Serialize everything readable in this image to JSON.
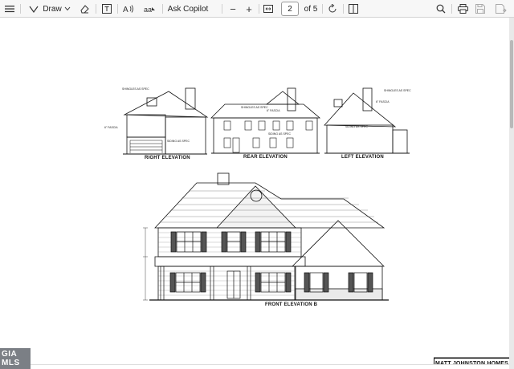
{
  "toolbar": {
    "draw_label": "Draw",
    "ask_copilot_label": "Ask Copilot",
    "zoom_out_label": "−",
    "zoom_in_label": "+",
    "page_current": "2",
    "page_total_label": "of 5"
  },
  "drawing": {
    "right_elevation_label": "RIGHT ELEVATION",
    "rear_elevation_label": "REAR ELEVATION",
    "left_elevation_label": "LEFT ELEVATION",
    "front_elevation_label": "FRONT ELEVATION B",
    "title_block": "MATT JOHNSTON HOMES",
    "note_shingles": "SHINGLES AS SPEC",
    "note_fascia": "6\" FASCIA",
    "note_siding": "SIDING AS SPEC"
  },
  "badge": {
    "mls_text": "GIA MLS"
  },
  "colors": {
    "toolbar_bg": "#f7f7f7",
    "viewer_bg": "#e6e6e6",
    "page_bg": "#ffffff",
    "line": "#111111"
  }
}
